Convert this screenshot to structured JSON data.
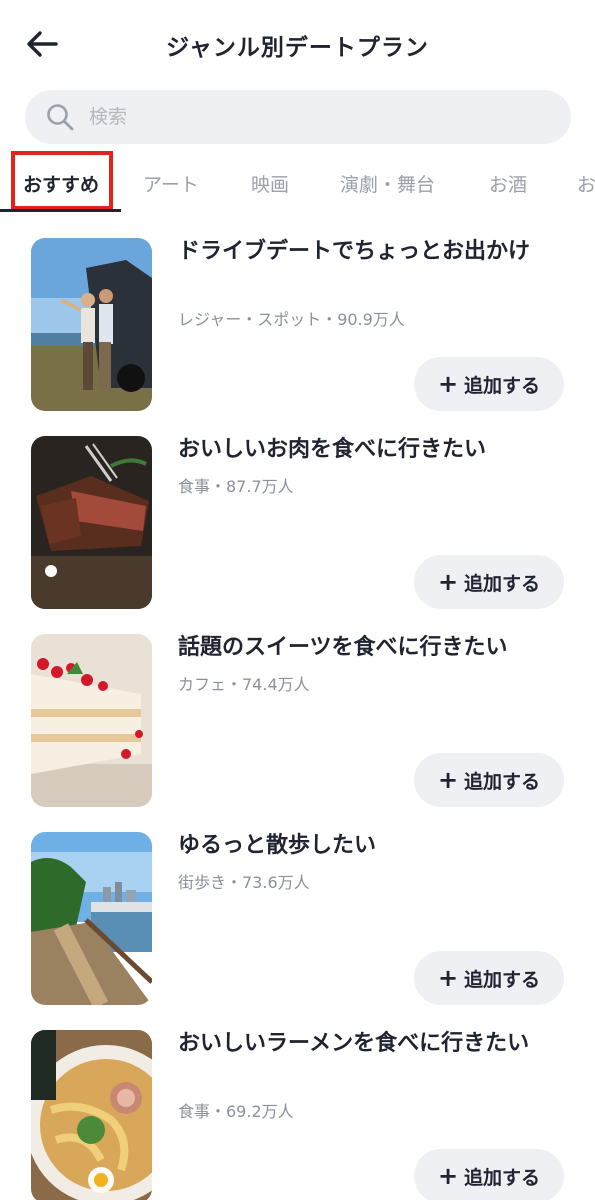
{
  "header": {
    "title": "ジャンル別デートプラン",
    "back_icon": "arrow-left-icon"
  },
  "search": {
    "placeholder": "検索",
    "icon": "search-icon"
  },
  "tabs": [
    {
      "label": "おすすめ",
      "active": true
    },
    {
      "label": "アート",
      "active": false
    },
    {
      "label": "映画",
      "active": false
    },
    {
      "label": "演劇・舞台",
      "active": false
    },
    {
      "label": "お酒",
      "active": false
    },
    {
      "label": "お",
      "active": false
    }
  ],
  "colors": {
    "highlight_box": "#e5231c",
    "text_primary": "#1f2430",
    "text_secondary": "#8b919a",
    "chip_bg": "#eef0f3"
  },
  "plans": [
    {
      "title": "ドライブデートでちょっとお出かけ",
      "meta": "レジャー・スポット・90.9万人",
      "add_label": "追加する",
      "image": "couple-by-car-at-seaside"
    },
    {
      "title": "おいしいお肉を食べに行きたい",
      "meta": "食事・87.7万人",
      "add_label": "追加する",
      "image": "grilled-steak"
    },
    {
      "title": "話題のスイーツを食べに行きたい",
      "meta": "カフェ・74.4万人",
      "add_label": "追加する",
      "image": "cake-with-berries"
    },
    {
      "title": "ゆるっと散歩したい",
      "meta": "街歩き・73.6万人",
      "add_label": "追加する",
      "image": "waterfront-promenade"
    },
    {
      "title": "おいしいラーメンを食べに行きたい",
      "meta": "食事・69.2万人",
      "add_label": "追加する",
      "image": "ramen-bowl"
    }
  ]
}
